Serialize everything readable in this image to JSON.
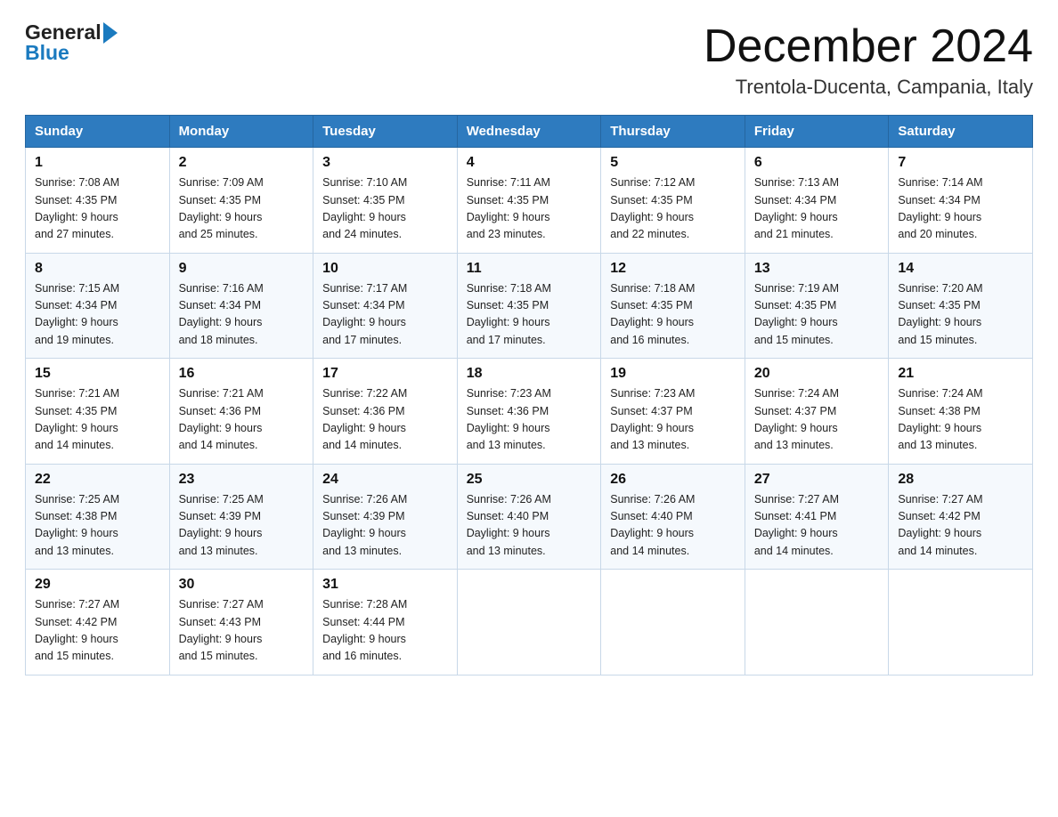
{
  "logo": {
    "general": "General",
    "blue": "Blue",
    "arrow_icon": "right-arrow-icon"
  },
  "title": {
    "month_year": "December 2024",
    "location": "Trentola-Ducenta, Campania, Italy"
  },
  "header_row": [
    "Sunday",
    "Monday",
    "Tuesday",
    "Wednesday",
    "Thursday",
    "Friday",
    "Saturday"
  ],
  "weeks": [
    [
      {
        "day": "1",
        "info": "Sunrise: 7:08 AM\nSunset: 4:35 PM\nDaylight: 9 hours\nand 27 minutes."
      },
      {
        "day": "2",
        "info": "Sunrise: 7:09 AM\nSunset: 4:35 PM\nDaylight: 9 hours\nand 25 minutes."
      },
      {
        "day": "3",
        "info": "Sunrise: 7:10 AM\nSunset: 4:35 PM\nDaylight: 9 hours\nand 24 minutes."
      },
      {
        "day": "4",
        "info": "Sunrise: 7:11 AM\nSunset: 4:35 PM\nDaylight: 9 hours\nand 23 minutes."
      },
      {
        "day": "5",
        "info": "Sunrise: 7:12 AM\nSunset: 4:35 PM\nDaylight: 9 hours\nand 22 minutes."
      },
      {
        "day": "6",
        "info": "Sunrise: 7:13 AM\nSunset: 4:34 PM\nDaylight: 9 hours\nand 21 minutes."
      },
      {
        "day": "7",
        "info": "Sunrise: 7:14 AM\nSunset: 4:34 PM\nDaylight: 9 hours\nand 20 minutes."
      }
    ],
    [
      {
        "day": "8",
        "info": "Sunrise: 7:15 AM\nSunset: 4:34 PM\nDaylight: 9 hours\nand 19 minutes."
      },
      {
        "day": "9",
        "info": "Sunrise: 7:16 AM\nSunset: 4:34 PM\nDaylight: 9 hours\nand 18 minutes."
      },
      {
        "day": "10",
        "info": "Sunrise: 7:17 AM\nSunset: 4:34 PM\nDaylight: 9 hours\nand 17 minutes."
      },
      {
        "day": "11",
        "info": "Sunrise: 7:18 AM\nSunset: 4:35 PM\nDaylight: 9 hours\nand 17 minutes."
      },
      {
        "day": "12",
        "info": "Sunrise: 7:18 AM\nSunset: 4:35 PM\nDaylight: 9 hours\nand 16 minutes."
      },
      {
        "day": "13",
        "info": "Sunrise: 7:19 AM\nSunset: 4:35 PM\nDaylight: 9 hours\nand 15 minutes."
      },
      {
        "day": "14",
        "info": "Sunrise: 7:20 AM\nSunset: 4:35 PM\nDaylight: 9 hours\nand 15 minutes."
      }
    ],
    [
      {
        "day": "15",
        "info": "Sunrise: 7:21 AM\nSunset: 4:35 PM\nDaylight: 9 hours\nand 14 minutes."
      },
      {
        "day": "16",
        "info": "Sunrise: 7:21 AM\nSunset: 4:36 PM\nDaylight: 9 hours\nand 14 minutes."
      },
      {
        "day": "17",
        "info": "Sunrise: 7:22 AM\nSunset: 4:36 PM\nDaylight: 9 hours\nand 14 minutes."
      },
      {
        "day": "18",
        "info": "Sunrise: 7:23 AM\nSunset: 4:36 PM\nDaylight: 9 hours\nand 13 minutes."
      },
      {
        "day": "19",
        "info": "Sunrise: 7:23 AM\nSunset: 4:37 PM\nDaylight: 9 hours\nand 13 minutes."
      },
      {
        "day": "20",
        "info": "Sunrise: 7:24 AM\nSunset: 4:37 PM\nDaylight: 9 hours\nand 13 minutes."
      },
      {
        "day": "21",
        "info": "Sunrise: 7:24 AM\nSunset: 4:38 PM\nDaylight: 9 hours\nand 13 minutes."
      }
    ],
    [
      {
        "day": "22",
        "info": "Sunrise: 7:25 AM\nSunset: 4:38 PM\nDaylight: 9 hours\nand 13 minutes."
      },
      {
        "day": "23",
        "info": "Sunrise: 7:25 AM\nSunset: 4:39 PM\nDaylight: 9 hours\nand 13 minutes."
      },
      {
        "day": "24",
        "info": "Sunrise: 7:26 AM\nSunset: 4:39 PM\nDaylight: 9 hours\nand 13 minutes."
      },
      {
        "day": "25",
        "info": "Sunrise: 7:26 AM\nSunset: 4:40 PM\nDaylight: 9 hours\nand 13 minutes."
      },
      {
        "day": "26",
        "info": "Sunrise: 7:26 AM\nSunset: 4:40 PM\nDaylight: 9 hours\nand 14 minutes."
      },
      {
        "day": "27",
        "info": "Sunrise: 7:27 AM\nSunset: 4:41 PM\nDaylight: 9 hours\nand 14 minutes."
      },
      {
        "day": "28",
        "info": "Sunrise: 7:27 AM\nSunset: 4:42 PM\nDaylight: 9 hours\nand 14 minutes."
      }
    ],
    [
      {
        "day": "29",
        "info": "Sunrise: 7:27 AM\nSunset: 4:42 PM\nDaylight: 9 hours\nand 15 minutes."
      },
      {
        "day": "30",
        "info": "Sunrise: 7:27 AM\nSunset: 4:43 PM\nDaylight: 9 hours\nand 15 minutes."
      },
      {
        "day": "31",
        "info": "Sunrise: 7:28 AM\nSunset: 4:44 PM\nDaylight: 9 hours\nand 16 minutes."
      },
      {
        "day": "",
        "info": ""
      },
      {
        "day": "",
        "info": ""
      },
      {
        "day": "",
        "info": ""
      },
      {
        "day": "",
        "info": ""
      }
    ]
  ]
}
